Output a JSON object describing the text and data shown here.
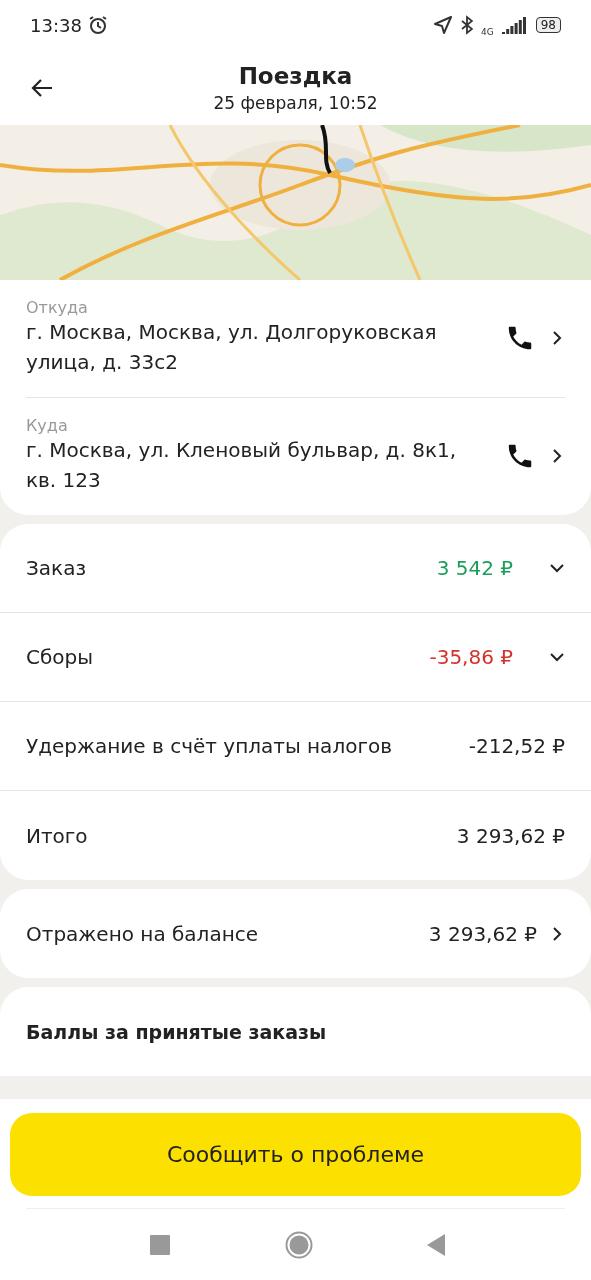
{
  "status_bar": {
    "time": "13:38",
    "network": "4G",
    "battery": "98"
  },
  "header": {
    "title": "Поездка",
    "subtitle": "25 февраля, 10:52"
  },
  "addresses": [
    {
      "label": "Откуда",
      "address": "г. Москва, Москва, ул. Долгоруковская улица, д. 33с2"
    },
    {
      "label": "Куда",
      "address": "г. Москва, ул. Кленовый бульвар, д. 8к1, кв. 123"
    }
  ],
  "summary": [
    {
      "kind": "expand",
      "label": "Заказ",
      "value": "3 542 ₽",
      "color": "#1b9e5a",
      "expanded": false
    },
    {
      "kind": "expand",
      "label": "Сборы",
      "value": "-35,86 ₽",
      "color": "#d0342c",
      "expanded": false
    },
    {
      "kind": "plain",
      "label": "Удержание в счёт уплаты налогов",
      "value": "-212,52 ₽",
      "color": "#222222"
    },
    {
      "kind": "plain",
      "label": "Итого",
      "value": "3 293,62 ₽",
      "color": "#222222"
    }
  ],
  "balance": {
    "label": "Отражено на балансе",
    "value": "3 293,62 ₽"
  },
  "points": {
    "title": "Баллы за принятые заказы"
  },
  "report_button": "Сообщить о проблеме"
}
